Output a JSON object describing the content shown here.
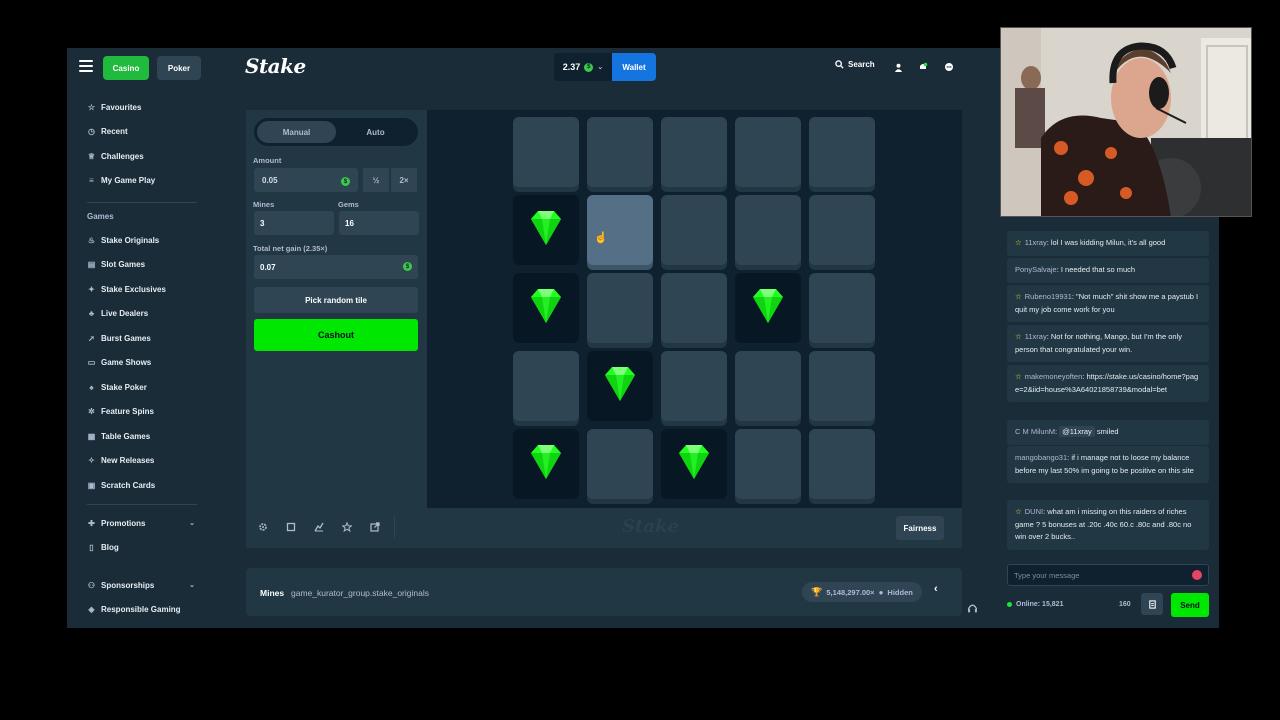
{
  "topbar": {
    "casino_label": "Casino",
    "poker_label": "Poker",
    "logo_text": "Stake",
    "balance": "2.37",
    "wallet_label": "Wallet",
    "search_label": "Search"
  },
  "sidebar": {
    "items_top": [
      {
        "label": "Favourites",
        "icon": "star-icon"
      },
      {
        "label": "Recent",
        "icon": "clock-icon"
      },
      {
        "label": "Challenges",
        "icon": "trophy-icon"
      },
      {
        "label": "My Game Play",
        "icon": "list-icon"
      }
    ],
    "games_heading": "Games",
    "games": [
      {
        "label": "Stake Originals",
        "icon": "fire-icon"
      },
      {
        "label": "Slot Games",
        "icon": "slots-icon"
      },
      {
        "label": "Stake Exclusives",
        "icon": "star-badge-icon"
      },
      {
        "label": "Live Dealers",
        "icon": "dealer-icon"
      },
      {
        "label": "Burst Games",
        "icon": "rocket-icon"
      },
      {
        "label": "Game Shows",
        "icon": "tv-icon"
      },
      {
        "label": "Stake Poker",
        "icon": "cards-icon"
      },
      {
        "label": "Feature Spins",
        "icon": "gear-icon"
      },
      {
        "label": "Table Games",
        "icon": "table-icon"
      },
      {
        "label": "New Releases",
        "icon": "new-icon"
      },
      {
        "label": "Scratch Cards",
        "icon": "ticket-icon"
      }
    ],
    "bottom": [
      {
        "label": "Promotions",
        "icon": "gift-icon",
        "chevron": true
      },
      {
        "label": "Blog",
        "icon": "document-icon",
        "chevron": false
      },
      {
        "label": "Sponsorships",
        "icon": "handshake-icon",
        "chevron": true
      },
      {
        "label": "Responsible Gaming",
        "icon": "shield-icon",
        "chevron": false
      }
    ]
  },
  "controls": {
    "mode_manual": "Manual",
    "mode_auto": "Auto",
    "amount_label": "Amount",
    "amount_value": "0.05",
    "half_label": "½",
    "double_label": "2×",
    "mines_label": "Mines",
    "mines_value": "3",
    "gems_label": "Gems",
    "gems_value": "16",
    "gain_label": "Total net gain (2.35×)",
    "gain_value": "0.07",
    "random_label": "Pick random tile",
    "cashout_label": "Cashout",
    "coin_symbol": "$"
  },
  "board": {
    "rows": 5,
    "cols": 5,
    "tiles": [
      "hidden",
      "hidden",
      "hidden",
      "hidden",
      "hidden",
      "gem",
      "hover",
      "hidden",
      "hidden",
      "hidden",
      "gem",
      "hidden",
      "hidden",
      "gem",
      "hidden",
      "hidden",
      "gem",
      "hidden",
      "hidden",
      "hidden",
      "gem",
      "hidden",
      "gem",
      "hidden",
      "hidden"
    ],
    "gem_color": "#1fff20"
  },
  "footer": {
    "logo_text": "Stake",
    "fairness_label": "Fairness"
  },
  "info": {
    "game_name": "Mines",
    "provider": "game_kurator_group.stake_originals",
    "stats": "5,148,297.00×",
    "hidden_label": "Hidden"
  },
  "chat": {
    "messages": [
      {
        "user": "11xray",
        "star": true,
        "text": "lol I was kidding Milun, it's all good"
      },
      {
        "user": "PonySalvaje",
        "star": false,
        "text": "I needed that so much"
      },
      {
        "user": "Rubeno19931",
        "star": true,
        "text": "\"Not much\" shit show me a paystub I quit my job come work for you"
      },
      {
        "user": "11xray",
        "star": true,
        "text": "Not for nothing, Mango, but I'm the only person that congratulated your win."
      },
      {
        "user": "makemoneyoften",
        "star": true,
        "text": "https://stake.us/casino/home?page=2&iid=house%3A64021858739&modal=bet"
      },
      {
        "user": "MilunM",
        "star": false,
        "prefix": "C M",
        "mention": "@11xray",
        "text": "smiled"
      },
      {
        "user": "mangobango31",
        "star": false,
        "text": "if i manage not to loose my balance before my last 50% im going to be positive on this site"
      },
      {
        "user": "DUNI",
        "star": true,
        "text": "what am i missing on this raiders of riches game ? 5 bonuses at .20c .40c 60.c .80c and .80c no win over 2 bucks.."
      }
    ],
    "input_placeholder": "Type your message",
    "online_label": "Online: 15,821",
    "char_count": "160",
    "send_label": "Send"
  }
}
